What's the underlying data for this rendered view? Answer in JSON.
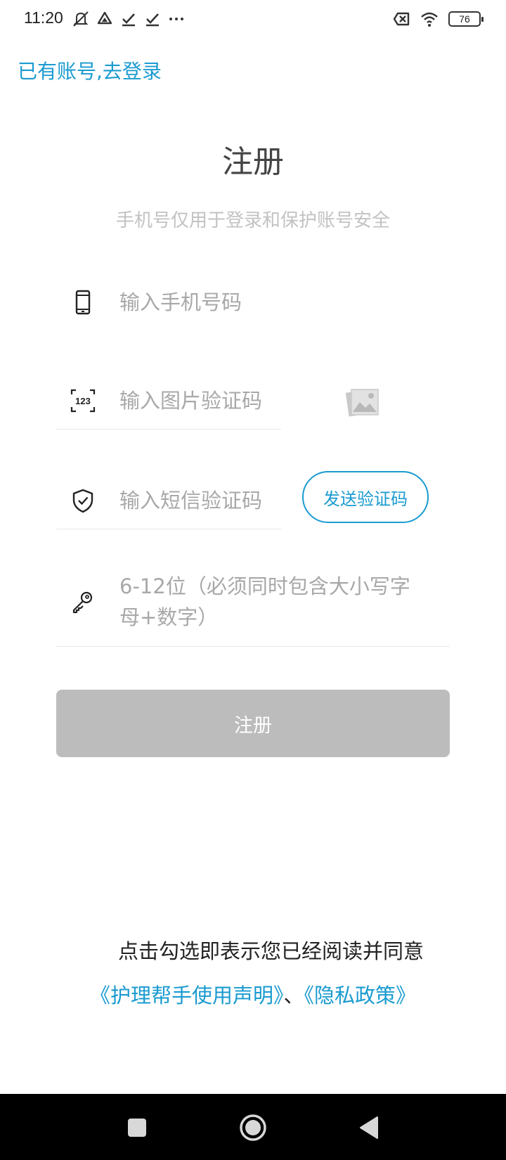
{
  "status_bar": {
    "time": "11:20",
    "battery": "76",
    "icons": [
      "mute-icon",
      "drive-icon",
      "check-icon",
      "check-icon",
      "more-icon",
      "sim-off-icon",
      "wifi-icon",
      "battery-icon"
    ]
  },
  "header": {
    "login_link": "已有账号,去登录",
    "title": "注册",
    "subtitle": "手机号仅用于登录和保护账号安全"
  },
  "form": {
    "phone_placeholder": "输入手机号码",
    "captcha_placeholder": "输入图片验证码",
    "sms_placeholder": "输入短信验证码",
    "send_code_label": "发送验证码",
    "password_placeholder": "6-12位（必须同时包含大小写字母+数字）",
    "register_label": "注册"
  },
  "agreement": {
    "text": "点击勾选即表示您已经阅读并同意",
    "terms_link": "《护理帮手使用声明》",
    "separator": "、",
    "privacy_link": "《隐私政策》"
  },
  "colors": {
    "accent": "#1a9bd0",
    "button_disabled": "#bcbcbc",
    "placeholder": "#a8a8a8"
  }
}
